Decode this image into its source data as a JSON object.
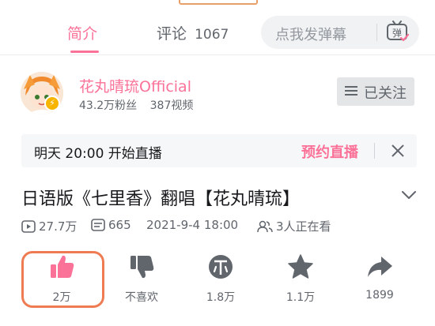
{
  "tabs": {
    "intro": "简介",
    "comments_label": "评论",
    "comments_count": "1067"
  },
  "danmaku": {
    "placeholder": "点我发弹幕",
    "button_glyph": "弹"
  },
  "uploader": {
    "name": "花丸晴琉Official",
    "fans": "43.2万粉丝",
    "videos": "387视频",
    "follow_label": "已关注"
  },
  "live": {
    "text": "明天 20:00 开始直播",
    "reserve_label": "预约直播"
  },
  "video": {
    "title": "日语版《七里香》翻唱【花丸晴琉】",
    "plays": "27.7万",
    "danmaku_count": "665",
    "date": "2021-9-4 18:00",
    "watching": "3人正在看"
  },
  "actions": {
    "like": "2万",
    "dislike": "不喜欢",
    "coin": "1.8万",
    "favorite": "1.1万",
    "share": "1899"
  },
  "colors": {
    "accent_pink": "#fb7299",
    "text_secondary": "#61666d",
    "highlight_orange": "#ef7b52"
  }
}
